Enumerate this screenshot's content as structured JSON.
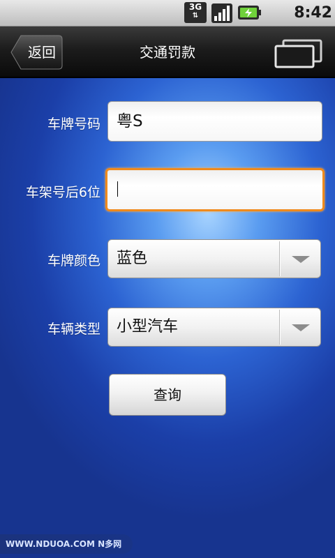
{
  "status_bar": {
    "network_type": "3G",
    "time": "8:42 AM"
  },
  "title_bar": {
    "back_label": "返回",
    "title": "交通罚款",
    "right_icon": "window-icon"
  },
  "form": {
    "plate_number": {
      "label": "车牌号码",
      "value": "粤S"
    },
    "frame_number": {
      "label": "车架号后6位",
      "value": ""
    },
    "plate_color": {
      "label": "车牌颜色",
      "selected": "蓝色"
    },
    "vehicle_type": {
      "label": "车辆类型",
      "selected": "小型汽车"
    },
    "query_label": "查询"
  },
  "watermark": "WWW.NDUOA.COM N多网",
  "colors": {
    "focus_border": "#f08a1c",
    "background_blue": "#2c63d2",
    "title_bar": "#1c1c1c"
  }
}
